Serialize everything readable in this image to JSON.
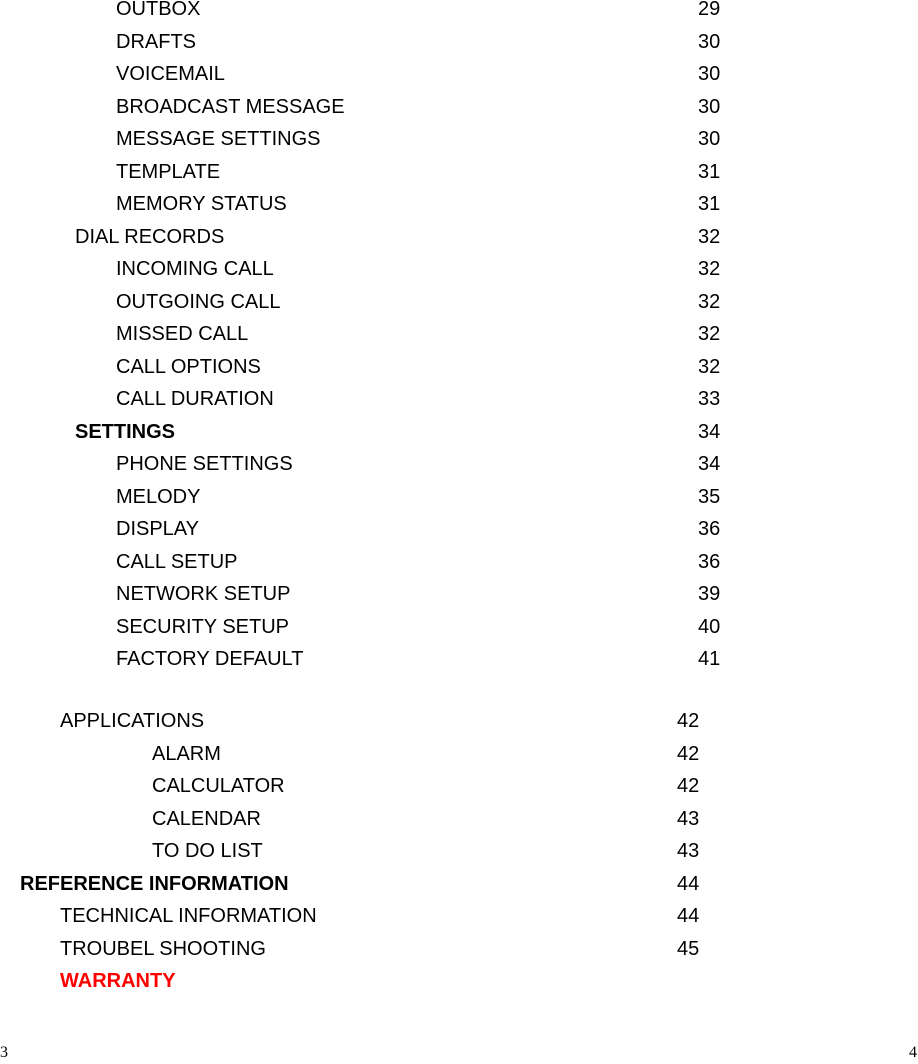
{
  "toc": {
    "block1": [
      {
        "label": "OUTBOX",
        "page": "29",
        "level": 2
      },
      {
        "label": "DRAFTS",
        "page": "30",
        "level": 2
      },
      {
        "label": "VOICEMAIL",
        "page": "30",
        "level": 2
      },
      {
        "label": "BROADCAST MESSAGE",
        "page": "30",
        "level": 2
      },
      {
        "label": "MESSAGE SETTINGS",
        "page": "30",
        "level": 2
      },
      {
        "label": "TEMPLATE",
        "page": "31",
        "level": 2
      },
      {
        "label": "MEMORY STATUS",
        "page": "31",
        "level": 2
      },
      {
        "label": "DIAL RECORDS",
        "page": "32",
        "level": 1
      },
      {
        "label": "INCOMING CALL",
        "page": "32",
        "level": 2
      },
      {
        "label": "OUTGOING CALL",
        "page": "32",
        "level": 2
      },
      {
        "label": "MISSED CALL",
        "page": "32",
        "level": 2
      },
      {
        "label": "CALL OPTIONS",
        "page": "32",
        "level": 2
      },
      {
        "label": "CALL DURATION",
        "page": "33",
        "level": 2
      },
      {
        "label": "SETTINGS",
        "page": "34",
        "level": 1,
        "bold": true
      },
      {
        "label": "PHONE SETTINGS",
        "page": "34",
        "level": 2
      },
      {
        "label": "MELODY",
        "page": "35",
        "level": 2
      },
      {
        "label": "DISPLAY",
        "page": "36",
        "level": 2
      },
      {
        "label": "CALL SETUP",
        "page": "36",
        "level": 2
      },
      {
        "label": "NETWORK SETUP",
        "page": "39",
        "level": 2
      },
      {
        "label": "SECURITY SETUP",
        "page": "40",
        "level": 2
      },
      {
        "label": "FACTORY DEFAULT",
        "page": "41",
        "level": 2
      }
    ],
    "block2": [
      {
        "label": "APPLICATIONS",
        "page": "42",
        "level": "b1"
      },
      {
        "label": "ALARM",
        "page": "42",
        "level": "b2"
      },
      {
        "label": "CALCULATOR",
        "page": "42",
        "level": "b2"
      },
      {
        "label": "CALENDAR",
        "page": "43",
        "level": "b2"
      },
      {
        "label": "TO DO LIST",
        "page": "43",
        "level": "b2"
      },
      {
        "label": "REFERENCE INFORMATION",
        "page": "44",
        "level": "b0",
        "bold": true
      },
      {
        "label": "TECHNICAL INFORMATION",
        "page": "44",
        "level": "b1"
      },
      {
        "label": "TROUBEL SHOOTING",
        "page": "45",
        "level": "b1"
      },
      {
        "label": "WARRANTY",
        "page": "",
        "level": "b1",
        "bold": true,
        "red": true
      }
    ]
  },
  "footer": {
    "left_page_number": "3",
    "right_page_number": "4"
  },
  "colors": {
    "text": "#000000",
    "warranty": "#ff0000"
  }
}
